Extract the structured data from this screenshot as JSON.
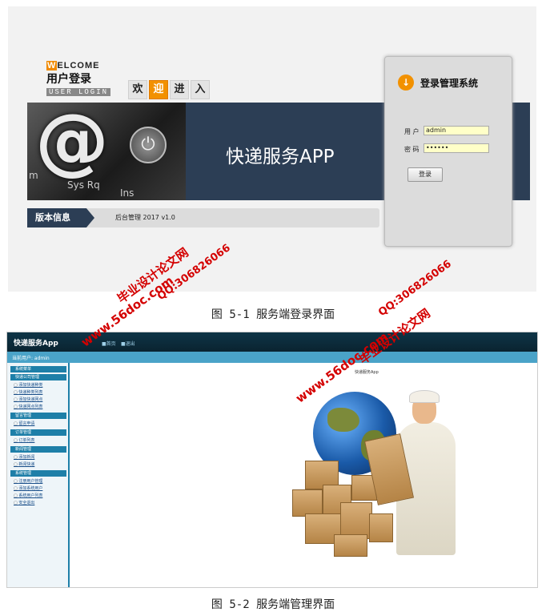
{
  "login_screen": {
    "welcome_first_letter": "W",
    "welcome_rest": "ELCOME",
    "user_login_cn": "用户登录",
    "user_login_en": "USER LOGIN",
    "welcome_tiles": [
      "欢",
      "迎",
      "进",
      "入"
    ],
    "banner_title": "快递服务APP",
    "banner_keys": [
      "Sys Rq",
      "Ins",
      "m"
    ],
    "version_label": "版本信息",
    "version_text": "后台管理 2017 v1.0",
    "login_panel": {
      "title": "登录管理系统",
      "user_label": "用 户",
      "user_value": "admin",
      "password_label": "密 码",
      "password_value": "••••••",
      "login_button": "登录"
    },
    "colors": {
      "accent": "#f29100",
      "banner": "#2c3e55"
    }
  },
  "caption1": "图 5-1 服务端登录界面",
  "admin_screen": {
    "app_title": "快递服务App",
    "top_links": [
      "■首页",
      "■退出"
    ],
    "subbar_text": "当前用户: admin",
    "menu": [
      {
        "group": "系统菜单",
        "items": []
      },
      {
        "group": "快递公司管理",
        "items": [
          "添加快递种类",
          "快递种类列表",
          "添加快递网点",
          "快递网点列表"
        ]
      },
      {
        "group": "留言管理",
        "items": [
          "留言申请"
        ]
      },
      {
        "group": "订单管理",
        "items": [
          "订单列表"
        ]
      },
      {
        "group": "新闻管理",
        "items": [
          "添加新闻",
          "新闻快递"
        ]
      },
      {
        "group": "系统管理",
        "items": [
          "注册用户管理",
          "添加系统用户",
          "系统用户列表",
          "安全退出"
        ]
      }
    ],
    "main_title": "快递服务App",
    "colors": {
      "topbar": "#0e3547",
      "accent": "#1e7fa8"
    }
  },
  "caption2": "图 5-2 服务端管理界面",
  "watermarks": {
    "site_name": "毕业设计论文网",
    "url": "www.56doc.com",
    "qq": "QQ:306826066"
  }
}
